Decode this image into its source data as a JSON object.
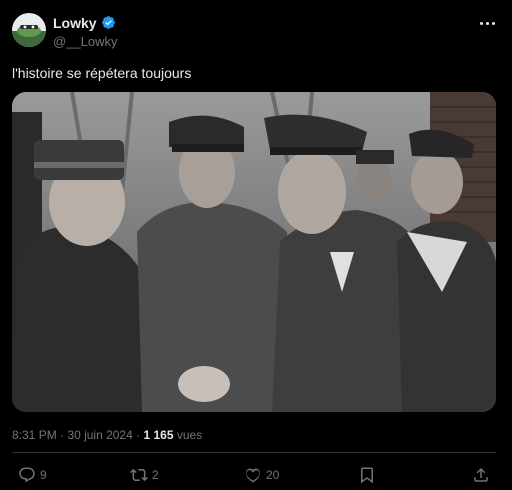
{
  "post": {
    "display_name": "Lowky",
    "handle": "@__Lowky",
    "verified": true,
    "text": "l'histoire se répétera toujours",
    "media_alt": "black-and-white historical photograph of uniformed men shaking hands",
    "time": "8:31 PM",
    "date": "30 juin 2024",
    "separator": "·",
    "views_count": "1 165",
    "views_label": "vues"
  },
  "actions": {
    "reply_count": "9",
    "repost_count": "2",
    "like_count": "20"
  },
  "icons": {
    "more": "more-horizontal-icon",
    "verified": "verified-badge-icon",
    "reply": "reply-icon",
    "repost": "repost-icon",
    "like": "heart-icon",
    "bookmark": "bookmark-icon",
    "share": "share-icon"
  },
  "colors": {
    "background": "#000000",
    "text": "#e7e9ea",
    "secondary": "#71767b",
    "verified": "#1d9bf0",
    "divider": "#2f3336"
  }
}
